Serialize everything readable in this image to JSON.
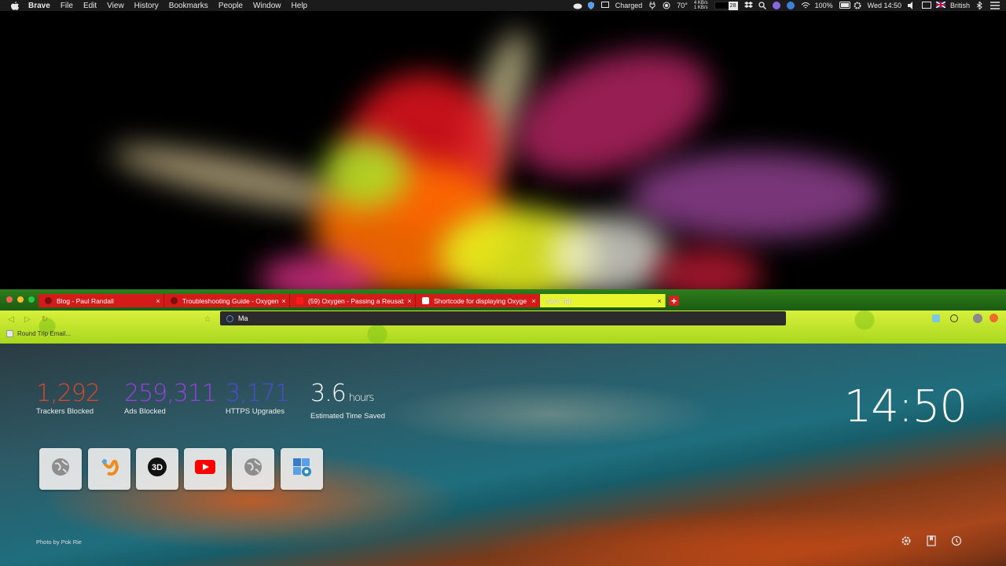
{
  "menubar": {
    "app_name": "Brave",
    "menus": [
      "File",
      "Edit",
      "View",
      "History",
      "Bookmarks",
      "People",
      "Window",
      "Help"
    ],
    "battery_status": "Charged",
    "temperature": "70°",
    "net_up": "4 KB/s",
    "net_down": "1 KB/s",
    "calendar_day": "28",
    "battery_percent": "100%",
    "datetime": "Wed 14:50",
    "input_source": "British"
  },
  "browser": {
    "tabs": [
      {
        "title": "Blog - Paul Randall"
      },
      {
        "title": "Troubleshooting Guide - Oxygen"
      },
      {
        "title": "(59) Oxygen - Passing a Reusab"
      },
      {
        "title": "Shortcode for displaying Oxyge"
      },
      {
        "title": "New Tab"
      }
    ],
    "address_value": "Ma",
    "bookmarks": [
      {
        "label": "Round Trip Email..."
      }
    ]
  },
  "newtab": {
    "stats": [
      {
        "value": "1,292",
        "label": "Trackers Blocked",
        "color": "#e0452d"
      },
      {
        "value": "259,311",
        "label": "Ads Blocked",
        "color": "#9b3fe0"
      },
      {
        "value": "3,171",
        "label": "HTTPS Upgrades",
        "color": "#4c4bd6"
      },
      {
        "value": "3.6",
        "unit": "hours",
        "label": "Estimated Time Saved",
        "color": "#ffffff"
      }
    ],
    "clock": "14:50",
    "top_sites": [
      {
        "icon": "globe-icon"
      },
      {
        "icon": "hook-logo-icon"
      },
      {
        "icon": "3d-logo-icon"
      },
      {
        "icon": "youtube-icon"
      },
      {
        "icon": "globe-icon"
      },
      {
        "icon": "puzzle-gear-icon"
      }
    ],
    "photo_credit": "Photo by Pok Rie"
  }
}
